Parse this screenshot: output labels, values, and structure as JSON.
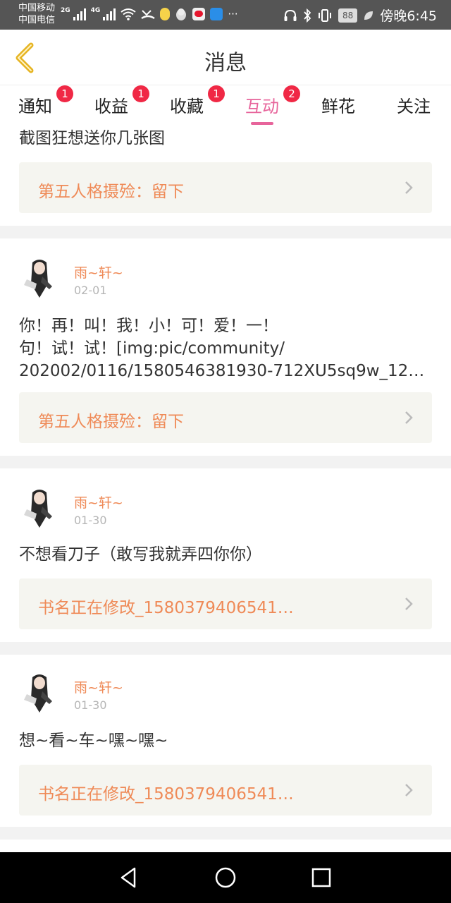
{
  "status_bar": {
    "carrier_1": "中国移动",
    "carrier_2": "中国电信",
    "net_1": "2G",
    "net_2": "4G",
    "more": "···",
    "battery": "88",
    "time": "傍晚6:45"
  },
  "header": {
    "title": "消息"
  },
  "tabs": [
    {
      "label": "通知",
      "badge": "1"
    },
    {
      "label": "收益",
      "badge": "1"
    },
    {
      "label": "收藏",
      "badge": "1"
    },
    {
      "label": "互动",
      "badge": "2",
      "active": true
    },
    {
      "label": "鲜花"
    },
    {
      "label": "关注"
    }
  ],
  "messages": [
    {
      "text": "截图狂想送你几张图",
      "ref": "第五人格摄殓：留下"
    },
    {
      "user": "雨~轩~",
      "date": "02-01",
      "text_lines": [
        "你！再！叫！我！小！可！爱！一！",
        "句！试！试！[img:pic/community/",
        "202002/0116/1580546381930-712XU5sq9w_12…"
      ],
      "ref": "第五人格摄殓：留下"
    },
    {
      "user": "雨~轩~",
      "date": "01-30",
      "text": "不想看刀子（敢写我就弄四你你）",
      "ref": "书名正在修改_1580379406541…"
    },
    {
      "user": "雨~轩~",
      "date": "01-30",
      "text": "想~看~车~嘿~嘿~",
      "ref": "书名正在修改_1580379406541…"
    }
  ],
  "colors": {
    "accent_pink": "#e7649b",
    "username_orange": "#ef8a57",
    "badge_red": "#f02845",
    "back_arrow": "#e6b422"
  },
  "icons": {
    "back": "chevron-left-icon",
    "ref_arrow": "chevron-right-icon",
    "nav": [
      "back-triangle-icon",
      "home-circle-icon",
      "recents-square-icon"
    ]
  }
}
